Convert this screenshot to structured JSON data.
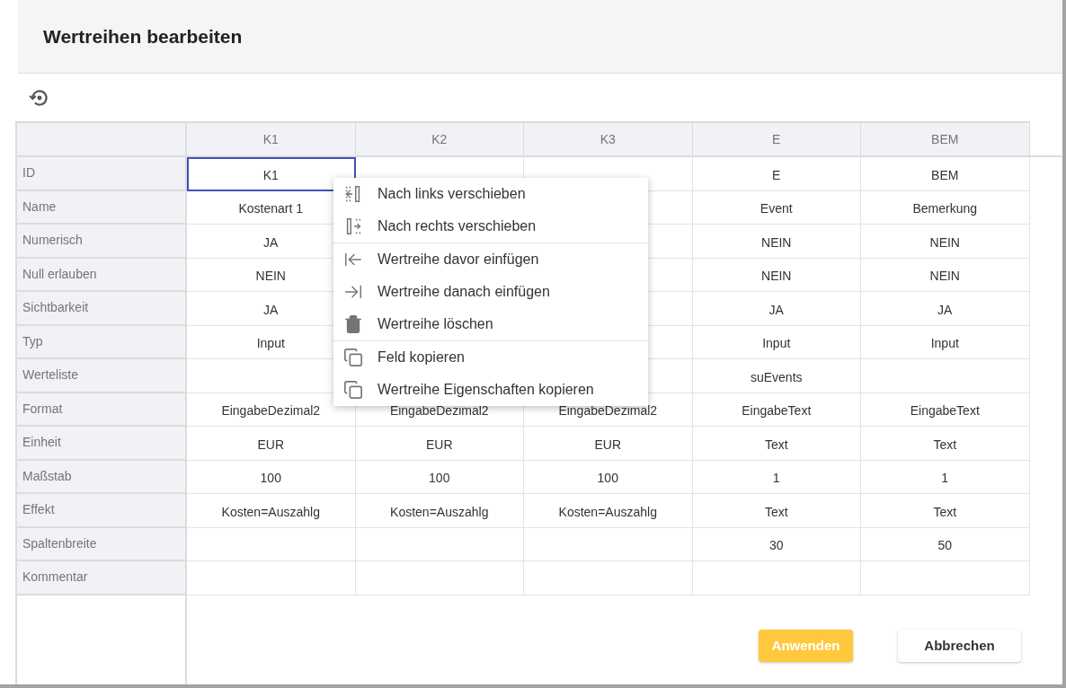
{
  "dialog": {
    "title": "Wertreihen bearbeiten"
  },
  "table": {
    "columns": [
      "K1",
      "K2",
      "K3",
      "E",
      "BEM"
    ],
    "rows": [
      {
        "label": "ID",
        "cells": [
          {
            "text": "K1",
            "selected": true
          },
          {},
          {},
          {
            "text": "E",
            "selected": false
          },
          {
            "text": "BEM",
            "selected": false
          }
        ]
      },
      {
        "label": "Name",
        "cells": [
          {
            "text": "Kostenart 1",
            "selected": false
          },
          {},
          {},
          {
            "text": "Event",
            "selected": false
          },
          {
            "text": "Bemerkung",
            "selected": false
          }
        ]
      },
      {
        "label": "Numerisch",
        "cells": [
          {
            "text": "JA",
            "selected": false
          },
          {},
          {},
          {
            "text": "NEIN",
            "selected": false
          },
          {
            "text": "NEIN",
            "selected": false
          }
        ]
      },
      {
        "label": "Null erlauben",
        "cells": [
          {
            "text": "NEIN",
            "selected": false
          },
          {},
          {},
          {
            "text": "NEIN",
            "selected": false
          },
          {
            "text": "NEIN",
            "selected": false
          }
        ]
      },
      {
        "label": "Sichtbarkeit",
        "cells": [
          {
            "text": "JA",
            "selected": false
          },
          {},
          {},
          {
            "text": "JA",
            "selected": false
          },
          {
            "text": "JA",
            "selected": false
          }
        ]
      },
      {
        "label": "Typ",
        "cells": [
          {
            "text": "Input",
            "selected": false
          },
          {},
          {},
          {
            "text": "Input",
            "selected": false
          },
          {
            "text": "Input",
            "selected": false
          }
        ]
      },
      {
        "label": "Werteliste",
        "cells": [
          {
            "selected": false
          },
          {},
          {},
          {
            "text": "suEvents",
            "selected": false
          },
          {
            "selected": false
          }
        ]
      },
      {
        "label": "Format",
        "cells": [
          {
            "text": "EingabeDezimal2",
            "selected": false
          },
          {
            "text": "EingabeDezimal2",
            "selected": false
          },
          {
            "text": "EingabeDezimal2",
            "selected": false
          },
          {
            "text": "EingabeText",
            "selected": false
          },
          {
            "text": "EingabeText",
            "selected": false
          }
        ]
      },
      {
        "label": "Einheit",
        "cells": [
          {
            "text": "EUR",
            "selected": false
          },
          {
            "text": "EUR",
            "selected": false
          },
          {
            "text": "EUR",
            "selected": false
          },
          {
            "text": "Text",
            "selected": false
          },
          {
            "text": "Text",
            "selected": false
          }
        ]
      },
      {
        "label": "Maßstab",
        "cells": [
          {
            "text": "100",
            "selected": false
          },
          {
            "text": "100",
            "selected": false
          },
          {
            "text": "100",
            "selected": false
          },
          {
            "text": "1",
            "selected": false
          },
          {
            "text": "1",
            "selected": false
          }
        ]
      },
      {
        "label": "Effekt",
        "cells": [
          {
            "text": "Kosten=Auszahlg",
            "selected": false
          },
          {
            "text": "Kosten=Auszahlg",
            "selected": false
          },
          {
            "text": "Kosten=Auszahlg",
            "selected": false
          },
          {
            "text": "Text",
            "selected": false
          },
          {
            "text": "Text",
            "selected": false
          }
        ]
      },
      {
        "label": "Spaltenbreite",
        "cells": [
          {
            "selected": false
          },
          {
            "selected": false
          },
          {
            "selected": false
          },
          {
            "text": "30",
            "selected": false
          },
          {
            "text": "50",
            "selected": false
          }
        ]
      },
      {
        "label": "Kommentar",
        "cells": [
          {
            "selected": false
          },
          {
            "selected": false
          },
          {
            "selected": false
          },
          {
            "selected": false
          },
          {
            "selected": false
          }
        ]
      }
    ]
  },
  "context_menu": {
    "groups": [
      [
        {
          "kind": "move-left",
          "label": "Nach links verschieben"
        },
        {
          "kind": "move-right",
          "label": "Nach rechts verschieben"
        }
      ],
      [
        {
          "kind": "insert-before",
          "label": "Wertreihe davor einfügen"
        },
        {
          "kind": "insert-after",
          "label": "Wertreihe danach einfügen"
        },
        {
          "kind": "delete",
          "label": "Wertreihe löschen"
        }
      ],
      [
        {
          "kind": "copy",
          "label": "Feld kopieren"
        },
        {
          "kind": "copy",
          "label": "Wertreihe Eigenschaften kopieren"
        }
      ]
    ]
  },
  "buttons": [
    {
      "kind": "primary",
      "label": "Anwenden"
    },
    {
      "kind": "secondary",
      "label": "Abbrechen"
    }
  ]
}
